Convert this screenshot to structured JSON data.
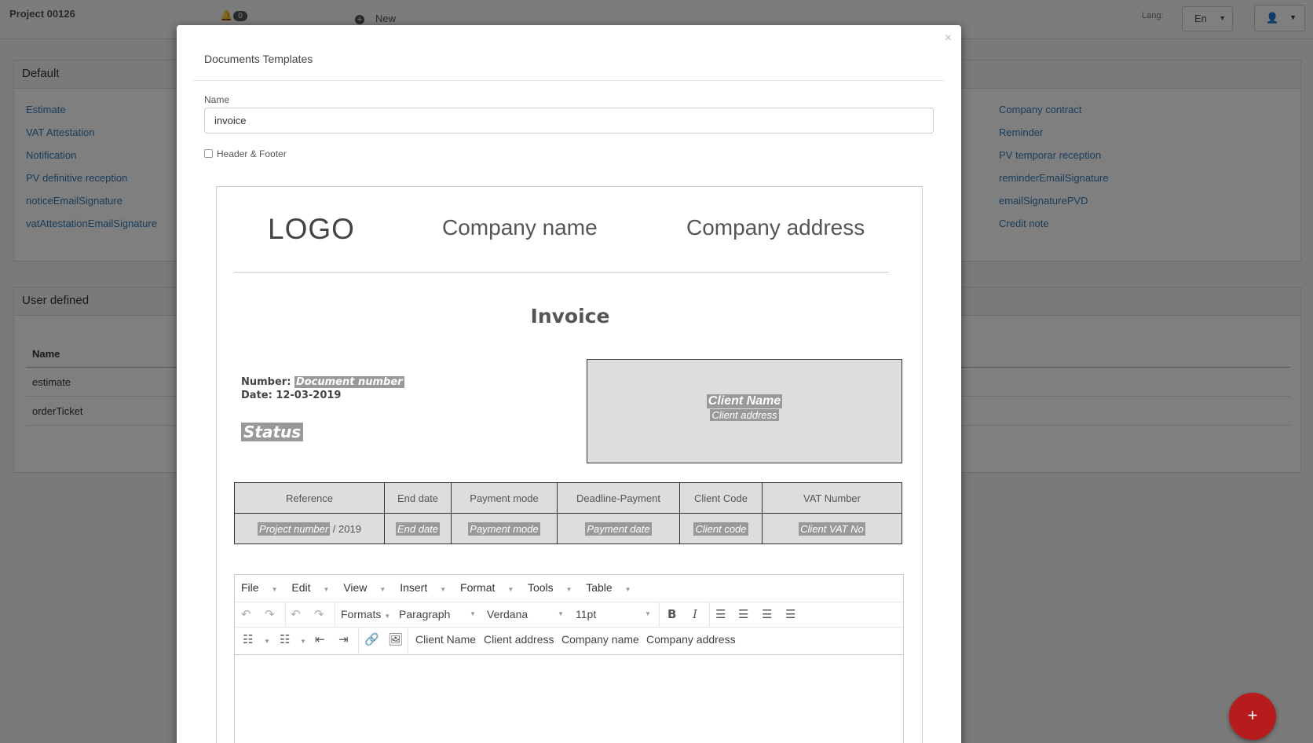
{
  "topbar": {
    "project": "Project 00126",
    "notif_count": "0",
    "new_label": "New",
    "lang_label": "Lang:",
    "lang_value": "En"
  },
  "default_panel": {
    "title": "Default",
    "left_links": [
      "Estimate",
      "VAT Attestation",
      "Notification",
      "PV definitive reception",
      "noticeEmailSignature",
      "vatAttestationEmailSignature"
    ],
    "right_links": [
      "Company contract",
      "Reminder",
      "PV temporar reception",
      "reminderEmailSignature",
      "emailSignaturePVD",
      "Credit note"
    ]
  },
  "user_panel": {
    "title": "User defined",
    "col_name": "Name",
    "rows": [
      "estimate",
      "orderTicket"
    ]
  },
  "modal": {
    "title": "Documents Templates",
    "close": "×",
    "name_label": "Name",
    "name_value": "invoice",
    "header_footer_label": "Header & Footer"
  },
  "doc": {
    "logo": "LOGO",
    "company_name": "Company name",
    "company_address": "Company address",
    "title": "Invoice",
    "number_label": "Number:",
    "number_value": "Document number",
    "date_line": "Date: 12-03-2019",
    "status": "Status",
    "client_name": "Client Name",
    "client_address": "Client address",
    "table_headers": [
      "Reference",
      "End date",
      "Payment mode",
      "Deadline-Payment",
      "Client Code",
      "VAT Number"
    ],
    "table_values": [
      "Project number",
      "End date",
      "Payment mode",
      "Payment date",
      "Client code",
      "Client VAT No"
    ],
    "ref_suffix": " / 2019"
  },
  "editor": {
    "menus": [
      "File",
      "Edit",
      "View",
      "Insert",
      "Format",
      "Tools",
      "Table"
    ],
    "formats": "Formats",
    "paragraph": "Paragraph",
    "font": "Verdana",
    "size": "11pt",
    "bold": "B",
    "italic": "I",
    "insert_buttons": [
      "Client Name",
      "Client address",
      "Company name",
      "Company address"
    ]
  },
  "fab": "+",
  "colors": {
    "fab": "#b71c1c",
    "tag": "#999999",
    "link": "#337ab7"
  }
}
